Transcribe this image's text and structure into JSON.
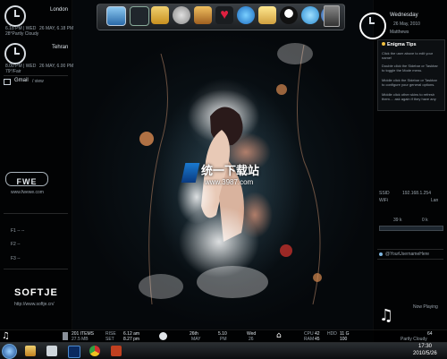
{
  "clocks": [
    {
      "city": "London",
      "line1": "6.18 PM | WED",
      "line2": "26 MAY, 6.18 PM",
      "line3": "28°Partly Cloudy"
    },
    {
      "city": "Tehran",
      "line1": "8.00 PM | WED",
      "line2": "26 MAY, 6.00 PM",
      "line3": "79°/Fair"
    }
  ],
  "gmail": {
    "label": "Gmail",
    "sub": "/ view"
  },
  "left_logo": "FWE",
  "left_url": "www.fwewe.com",
  "left_list": [
    "F1 -- --",
    "F2 --",
    "F3 --"
  ],
  "brand": {
    "logo": "SOFTJE",
    "url": "http://www.softje.cn/"
  },
  "right_clock": {
    "day": "Wednesday",
    "date": "26 May, 2010",
    "user": "Matthews"
  },
  "tips": {
    "title": "Enigma Tips",
    "lines": [
      "Click the user above to edit your name!",
      "Double click the Sidebar or Taskbar to toggle the Mode menu.",
      "Middle click the Sidebar or Taskbar to configure your general options.",
      "Middle click other skins to refresh them.... ask again if they have any"
    ]
  },
  "network": {
    "ssid_label": "SSID",
    "ssid_value": "192.168.1.254",
    "wifi_label": "WiFi",
    "wifi_value": "Lan",
    "speed_down": "39 k",
    "speed_up": "0 k"
  },
  "twitter": {
    "handle": "@YourUsernameHere"
  },
  "now_playing": {
    "label": "Now Playing"
  },
  "watermark": {
    "site": "www.3987.com",
    "brand": "统一下载站"
  },
  "info_bar": {
    "items": "201 ITEMS",
    "size": "27.5 MB",
    "time1": "6.12 am",
    "time2": "8.27 pm",
    "rise": "RISE",
    "set": "SET",
    "hum": "26th",
    "hum_label": "MAY",
    "temp": "5.10",
    "temp_label": "PM",
    "day": "Wed",
    "day_label": "26",
    "cpu": "42",
    "ram": "45",
    "cpu_label": "CPU",
    "ram_label": "RAM",
    "disk1": "11 G",
    "disk2": "100",
    "disk_label": "HDD",
    "weather": "64",
    "weather_label": "Partly Cloudy"
  },
  "taskbar": {
    "time": "17:30",
    "date": "2010/5/26"
  }
}
